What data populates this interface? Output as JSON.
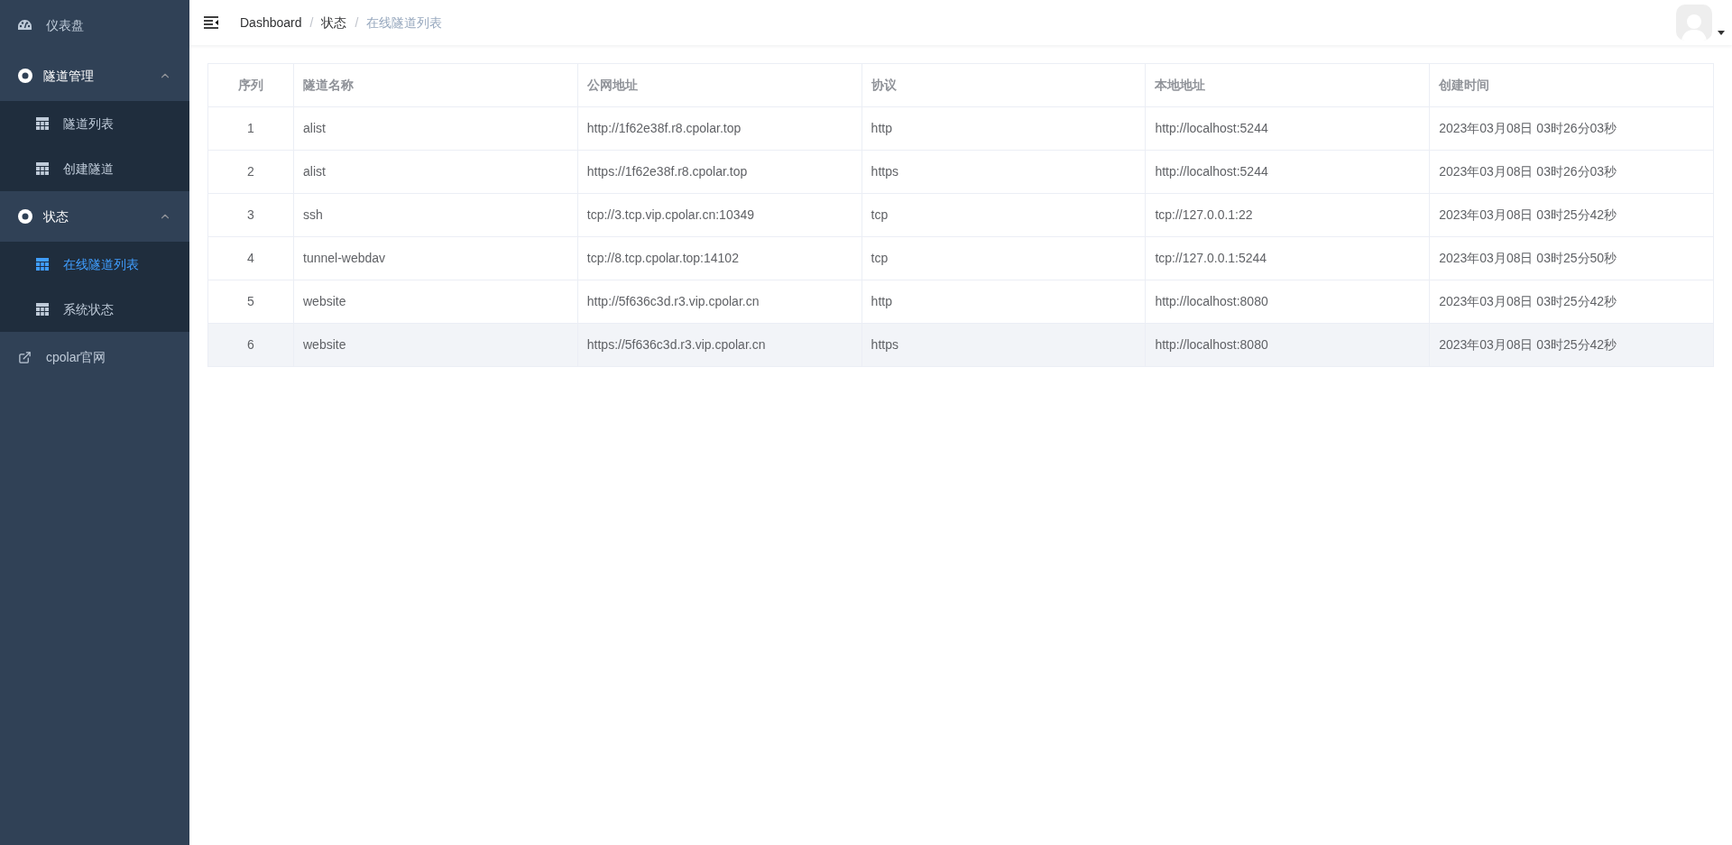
{
  "sidebar": {
    "items": [
      {
        "kind": "dashboard",
        "label": "仪表盘"
      },
      {
        "kind": "group",
        "label": "隧道管理",
        "expanded": true,
        "children": [
          {
            "label": "隧道列表",
            "selected": false
          },
          {
            "label": "创建隧道",
            "selected": false
          }
        ]
      },
      {
        "kind": "group",
        "label": "状态",
        "expanded": true,
        "children": [
          {
            "label": "在线隧道列表",
            "selected": true
          },
          {
            "label": "系统状态",
            "selected": false
          }
        ]
      },
      {
        "kind": "external",
        "label": "cpolar官网"
      }
    ]
  },
  "breadcrumb": [
    {
      "text": "Dashboard"
    },
    {
      "separator": "/",
      "text": "状态"
    },
    {
      "separator": "/",
      "text": "在线隧道列表"
    }
  ],
  "table": {
    "columns": [
      "序列",
      "隧道名称",
      "公网地址",
      "协议",
      "本地地址",
      "创建时间"
    ],
    "rows": [
      {
        "selected": false,
        "cells": [
          "1",
          "alist",
          "http://1f62e38f.r8.cpolar.top",
          "http",
          "http://localhost:5244",
          "2023年03月08日 03时26分03秒"
        ]
      },
      {
        "selected": false,
        "cells": [
          "2",
          "alist",
          "https://1f62e38f.r8.cpolar.top",
          "https",
          "http://localhost:5244",
          "2023年03月08日 03时26分03秒"
        ]
      },
      {
        "selected": false,
        "cells": [
          "3",
          "ssh",
          "tcp://3.tcp.vip.cpolar.cn:10349",
          "tcp",
          "tcp://127.0.0.1:22",
          "2023年03月08日 03时25分42秒"
        ]
      },
      {
        "selected": false,
        "cells": [
          "4",
          "tunnel-webdav",
          "tcp://8.tcp.cpolar.top:14102",
          "tcp",
          "tcp://127.0.0.1:5244",
          "2023年03月08日 03时25分50秒"
        ]
      },
      {
        "selected": false,
        "cells": [
          "5",
          "website",
          "http://5f636c3d.r3.vip.cpolar.cn",
          "http",
          "http://localhost:8080",
          "2023年03月08日 03时25分42秒"
        ]
      },
      {
        "selected": true,
        "cells": [
          "6",
          "website",
          "https://5f636c3d.r3.vip.cpolar.cn",
          "https",
          "http://localhost:8080",
          "2023年03月08日 03时25分42秒"
        ]
      }
    ]
  }
}
